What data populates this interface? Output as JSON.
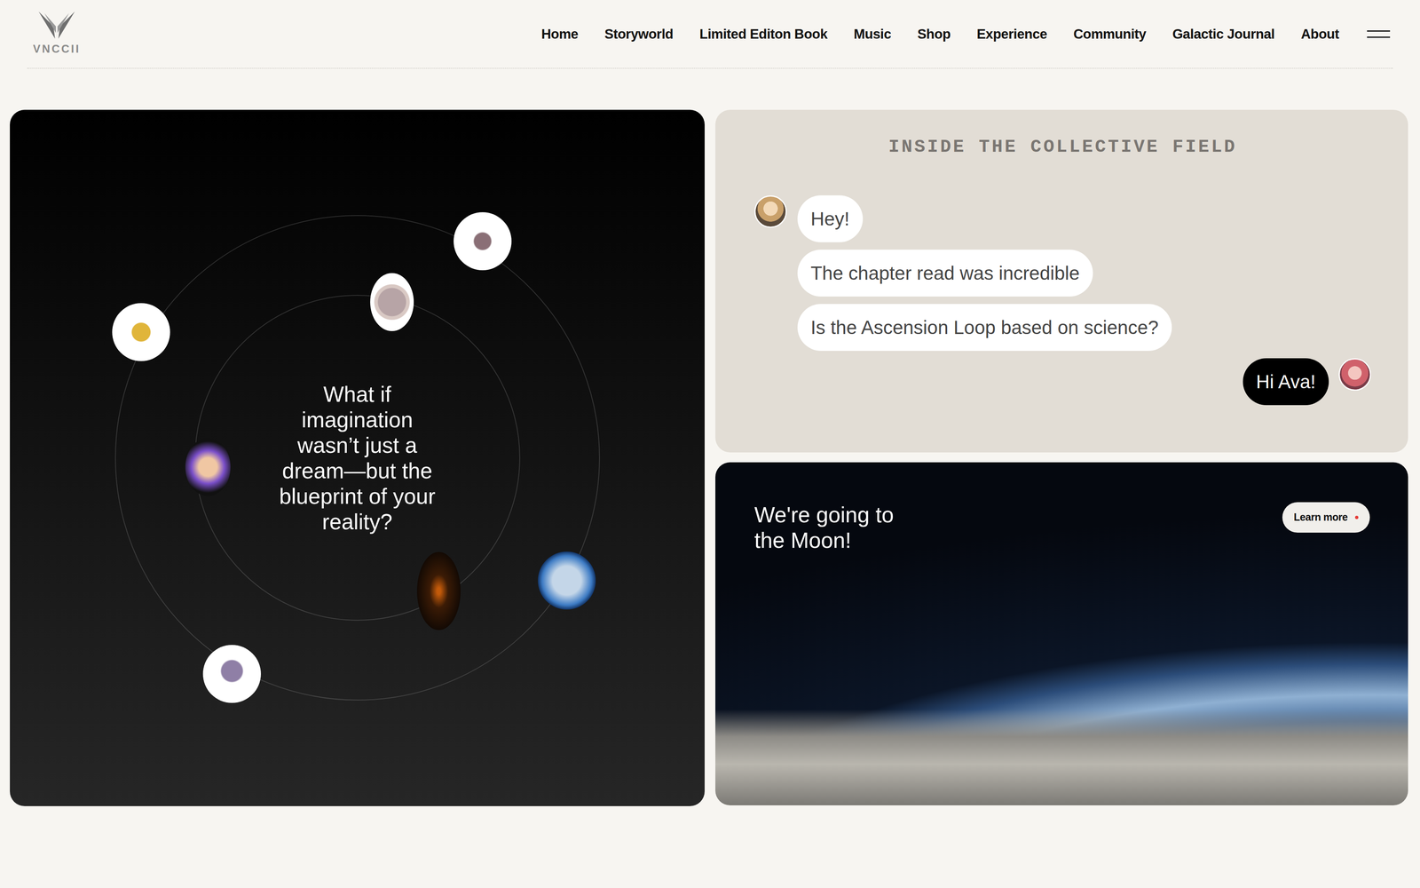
{
  "brand": {
    "name": "VNCCII"
  },
  "nav": {
    "items": [
      "Home",
      "Storyworld",
      "Limited Editon Book",
      "Music",
      "Shop",
      "Experience",
      "Community",
      "Galactic Journal",
      "About"
    ]
  },
  "orbit": {
    "headline": [
      "What if",
      "imagination",
      "wasn’t just a",
      "dream—but the",
      "blueprint of your",
      "reality?"
    ]
  },
  "chat": {
    "title": "INSIDE THE COLLECTIVE FIELD",
    "messages": [
      {
        "text": "Hey!",
        "kind": "incoming"
      },
      {
        "text": "The chapter read was incredible",
        "kind": "incoming"
      },
      {
        "text": "Is the Ascension Loop based on science?",
        "kind": "incoming"
      },
      {
        "text": "Hi Ava!",
        "kind": "outgoing"
      }
    ]
  },
  "promo": {
    "title": [
      "We're going to",
      "the Moon!"
    ],
    "button": "Learn more"
  }
}
